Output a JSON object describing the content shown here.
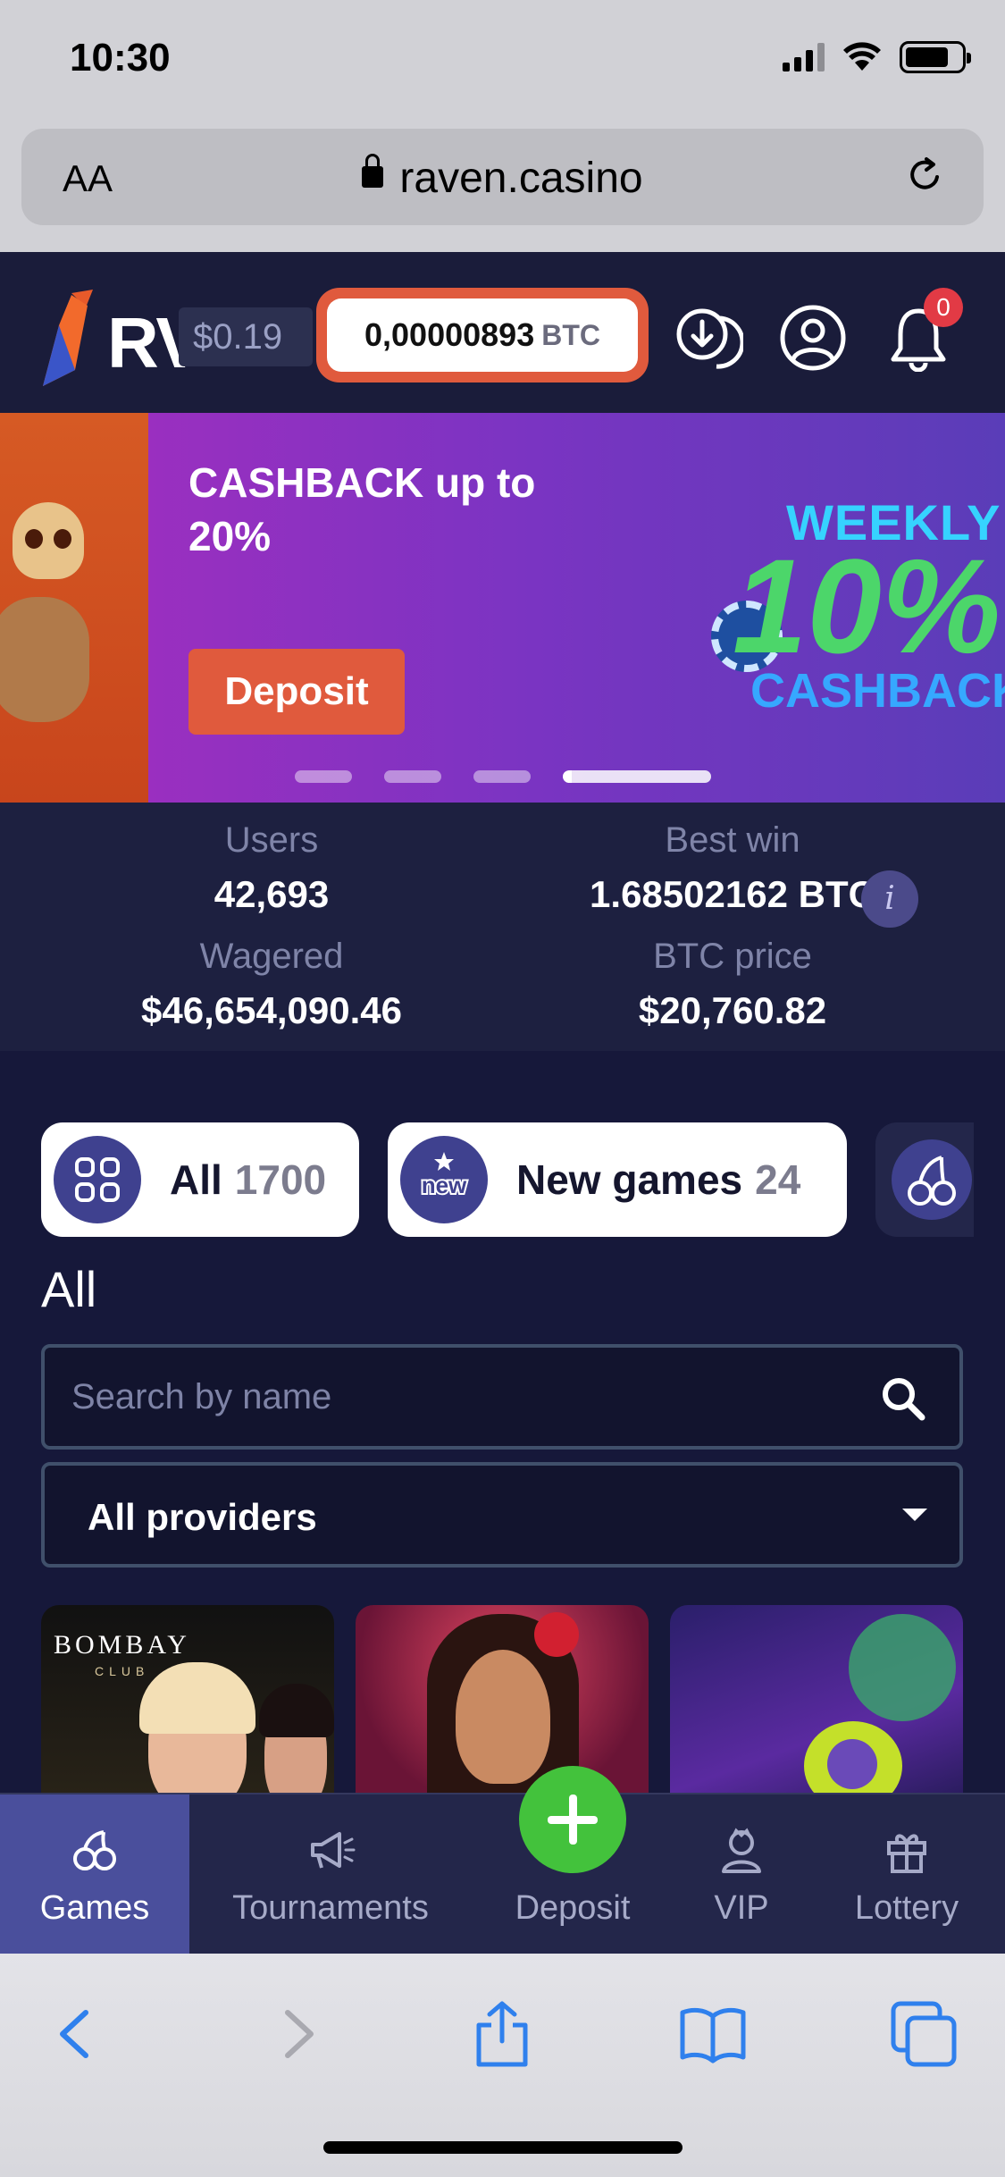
{
  "status_bar": {
    "time": "10:30"
  },
  "browser": {
    "text_size_label": "AA",
    "url": "raven.casino"
  },
  "header": {
    "logo_text": "RV",
    "usd_balance": "$0.19",
    "btc_amount": "0,00000893",
    "btc_unit": "BTC",
    "notification_count": "0"
  },
  "banner": {
    "title": "CASHBACK up to 20%",
    "button_label": "Deposit",
    "promo_art_text": [
      "WEEKLY",
      "10%",
      "CASHBACK"
    ],
    "slide_count": 4,
    "active_slide": 4
  },
  "stats": {
    "users_label": "Users",
    "users_value": "42,693",
    "best_win_label": "Best win",
    "best_win_value": "1.68502162 BTC",
    "wagered_label": "Wagered",
    "wagered_value": "$46,654,090.46",
    "btc_price_label": "BTC price",
    "btc_price_value": "$20,760.82",
    "info_icon_text": "i"
  },
  "categories": [
    {
      "label": "All",
      "count": "1700",
      "icon": "grid-icon"
    },
    {
      "label": "New games",
      "count": "24",
      "icon": "new-badge-icon",
      "icon_text": "new"
    },
    {
      "label": "",
      "count": "",
      "icon": "cherry-icon"
    }
  ],
  "games": {
    "section_title": "All",
    "search_placeholder": "Search by name",
    "provider_selected": "All providers",
    "cards": [
      {
        "name": "bombay-club",
        "logo_text": "BOMBAY",
        "sub_text": "CLUB"
      },
      {
        "name": "gypsy-woman"
      },
      {
        "name": "space-alien"
      }
    ]
  },
  "bottom_nav": [
    {
      "label": "Games",
      "icon": "cherry-icon",
      "active": true
    },
    {
      "label": "Tournaments",
      "icon": "megaphone-icon",
      "active": false
    },
    {
      "label": "Deposit",
      "icon": "plus-icon",
      "active": false
    },
    {
      "label": "VIP",
      "icon": "vip-icon",
      "active": false
    },
    {
      "label": "Lottery",
      "icon": "gift-icon",
      "active": false
    }
  ],
  "colors": {
    "accent": "#e05a3d",
    "deposit_green": "#43c23c",
    "nav_active": "#4a4f9c",
    "background": "#1a1c3a"
  }
}
